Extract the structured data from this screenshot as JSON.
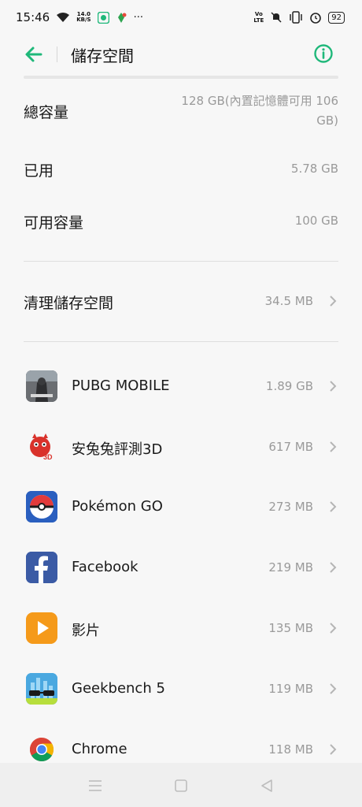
{
  "status_bar": {
    "time": "15:46",
    "net_speed_value": "14.0",
    "net_speed_unit": "KB/S",
    "volte_top": "Vo",
    "volte_bottom": "LTE",
    "battery": "92",
    "more": "···"
  },
  "header": {
    "title": "儲存空間"
  },
  "storage": {
    "total_label": "總容量",
    "total_value": "128 GB(內置記憶體可用 106 GB)",
    "used_label": "已用",
    "used_value": "5.78 GB",
    "available_label": "可用容量",
    "available_value": "100 GB",
    "clean_label": "清理儲存空間",
    "clean_value": "34.5 MB"
  },
  "apps": [
    {
      "name": "PUBG MOBILE",
      "size": "1.89 GB",
      "icon": "pubg-icon"
    },
    {
      "name": "安兔兔評測3D",
      "size": "617 MB",
      "icon": "antutu-3d-icon"
    },
    {
      "name": "Pokémon GO",
      "size": "273 MB",
      "icon": "pokeball-icon"
    },
    {
      "name": "Facebook",
      "size": "219 MB",
      "icon": "facebook-icon"
    },
    {
      "name": "影片",
      "size": "135 MB",
      "icon": "video-play-icon"
    },
    {
      "name": "Geekbench 5",
      "size": "119 MB",
      "icon": "geekbench-icon"
    },
    {
      "name": "Chrome",
      "size": "118 MB",
      "icon": "chrome-icon"
    }
  ],
  "colors": {
    "accent": "#1fb87a",
    "label": "#1a1a1a",
    "value": "#9a9a9a",
    "background": "#f7f7f7"
  },
  "icons": {
    "antutu_badge": "3D"
  }
}
